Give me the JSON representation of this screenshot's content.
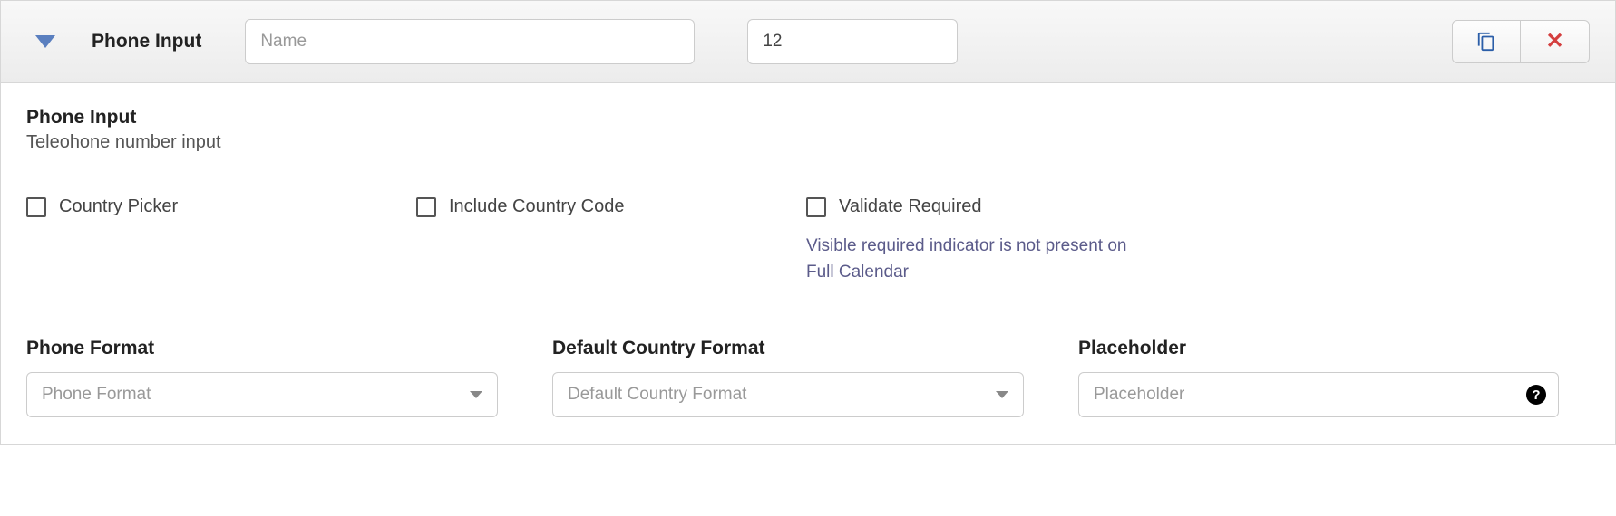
{
  "header": {
    "title": "Phone Input",
    "name_placeholder": "Name",
    "name_value": "",
    "order_value": "12"
  },
  "section": {
    "title": "Phone Input",
    "subtitle": "Teleohone number input"
  },
  "checkboxes": {
    "country_picker": "Country Picker",
    "include_country_code": "Include Country Code",
    "validate_required": "Validate Required",
    "validate_help": "Visible required indicator is not present on Full Calendar"
  },
  "fields": {
    "phone_format": {
      "label": "Phone Format",
      "placeholder": "Phone Format"
    },
    "default_country": {
      "label": "Default Country Format",
      "placeholder": "Default Country Format"
    },
    "placeholder": {
      "label": "Placeholder",
      "placeholder": "Placeholder"
    }
  },
  "icons": {
    "copy": "copy-icon",
    "delete": "close-icon",
    "help": "?"
  }
}
